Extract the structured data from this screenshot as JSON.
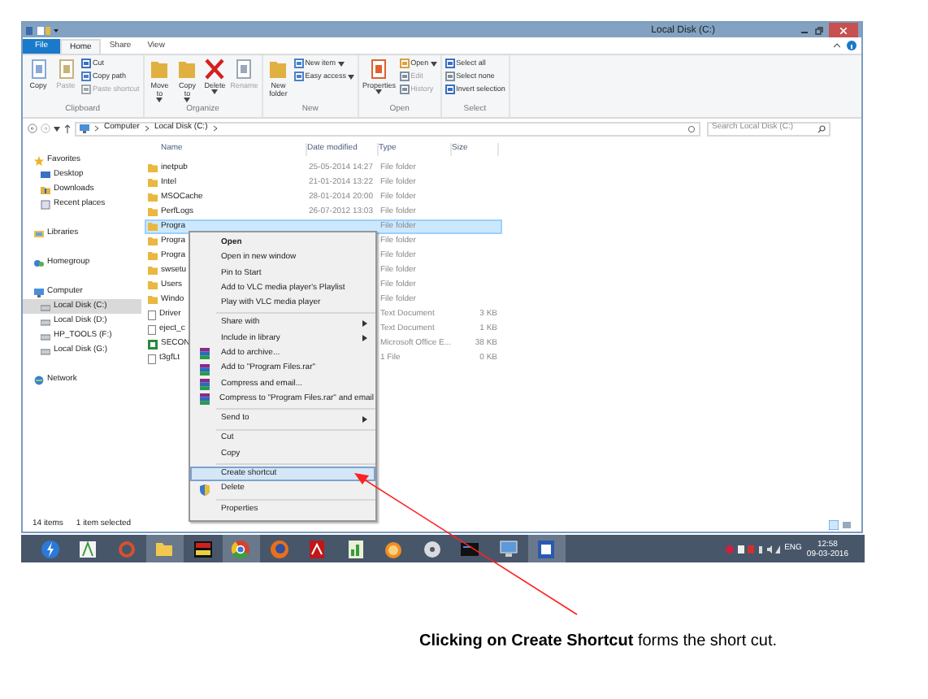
{
  "window": {
    "title": "Local Disk (C:)"
  },
  "ribbon_tabs": [
    {
      "label": "File",
      "kind": "file",
      "selected": false
    },
    {
      "label": "Home",
      "kind": "tab",
      "selected": true
    },
    {
      "label": "Share",
      "kind": "tab",
      "selected": false
    },
    {
      "label": "View",
      "kind": "tab",
      "selected": false
    }
  ],
  "ribbon_groups": [
    {
      "label": "Clipboard",
      "items": [
        {
          "label": "Copy",
          "kind": "large",
          "menu": false,
          "disabled": false
        },
        {
          "label": "Paste",
          "kind": "large",
          "menu": false,
          "disabled": true
        },
        {
          "label": "Cut",
          "kind": "small",
          "menu": false,
          "disabled": false
        },
        {
          "label": "Copy path",
          "kind": "small",
          "menu": false,
          "disabled": false
        },
        {
          "label": "Paste shortcut",
          "kind": "small",
          "menu": false,
          "disabled": true
        }
      ]
    },
    {
      "label": "Organize",
      "items": [
        {
          "label": "Move to",
          "kind": "large",
          "menu": true,
          "disabled": false
        },
        {
          "label": "Copy to",
          "kind": "large",
          "menu": true,
          "disabled": false
        },
        {
          "label": "Delete",
          "kind": "large",
          "menu": true,
          "disabled": false
        },
        {
          "label": "Rename",
          "kind": "large",
          "menu": false,
          "disabled": true
        }
      ]
    },
    {
      "label": "New",
      "items": [
        {
          "label": "New folder",
          "kind": "large",
          "menu": false,
          "disabled": false
        },
        {
          "label": "New item",
          "kind": "small",
          "menu": true,
          "disabled": false
        },
        {
          "label": "Easy access",
          "kind": "small",
          "menu": true,
          "disabled": false
        }
      ]
    },
    {
      "label": "Open",
      "items": [
        {
          "label": "Properties",
          "kind": "large",
          "menu": true,
          "disabled": false
        },
        {
          "label": "Open",
          "kind": "small",
          "menu": true,
          "disabled": false
        },
        {
          "label": "Edit",
          "kind": "small",
          "menu": false,
          "disabled": true
        },
        {
          "label": "History",
          "kind": "small",
          "menu": false,
          "disabled": true
        }
      ]
    },
    {
      "label": "Select",
      "items": [
        {
          "label": "Select all",
          "kind": "small",
          "menu": false,
          "disabled": false
        },
        {
          "label": "Select none",
          "kind": "small",
          "menu": false,
          "disabled": false
        },
        {
          "label": "Invert selection",
          "kind": "small",
          "menu": false,
          "disabled": false
        }
      ]
    }
  ],
  "address": {
    "path": [
      "Computer",
      "Local Disk (C:)"
    ]
  },
  "search": {
    "placeholder": "Search Local Disk (C:)"
  },
  "sidebar": [
    {
      "label": "Favorites",
      "kind": "star",
      "selected": false,
      "children": [
        {
          "label": "Desktop",
          "kind": "desktop",
          "selected": false
        },
        {
          "label": "Downloads",
          "kind": "downloads",
          "selected": false
        },
        {
          "label": "Recent places",
          "kind": "recent",
          "selected": false
        }
      ]
    },
    {
      "label": "Libraries",
      "kind": "library",
      "selected": false
    },
    {
      "label": "Homegroup",
      "kind": "homegroup",
      "selected": false
    },
    {
      "label": "Computer",
      "kind": "computer",
      "selected": false,
      "children": [
        {
          "label": "Local Disk (C:)",
          "kind": "drive",
          "selected": true
        },
        {
          "label": "Local Disk (D:)",
          "kind": "drive",
          "selected": false
        },
        {
          "label": "HP_TOOLS (F:)",
          "kind": "drive",
          "selected": false
        },
        {
          "label": "Local Disk (G:)",
          "kind": "drive",
          "selected": false
        }
      ]
    },
    {
      "label": "Network",
      "kind": "network",
      "selected": false
    }
  ],
  "columns": [
    "Name",
    "Date modified",
    "Type",
    "Size"
  ],
  "rows": [
    {
      "name": "inetpub",
      "date": "25-05-2014 14:27",
      "type": "File folder",
      "kind": "folder",
      "selected": false
    },
    {
      "name": "Intel",
      "date": "21-01-2014 13:22",
      "type": "File folder",
      "kind": "folder",
      "selected": false
    },
    {
      "name": "MSOCache",
      "date": "28-01-2014 20:00",
      "type": "File folder",
      "kind": "folder",
      "selected": false
    },
    {
      "name": "PerfLogs",
      "date": "26-07-2012 13:03",
      "type": "File folder",
      "kind": "folder",
      "selected": false
    },
    {
      "name": "Progra",
      "type": "File folder",
      "kind": "folder",
      "selected": true
    },
    {
      "name": "Progra",
      "type": "File folder",
      "kind": "folder",
      "selected": false
    },
    {
      "name": "Progra",
      "type": "File folder",
      "kind": "folder",
      "selected": false
    },
    {
      "name": "swsetu",
      "type": "File folder",
      "kind": "folder",
      "selected": false
    },
    {
      "name": "Users",
      "type": "File folder",
      "kind": "folder",
      "selected": false
    },
    {
      "name": "Windo",
      "type": "File folder",
      "kind": "folder",
      "selected": false
    },
    {
      "name": "Driver",
      "type": "Text Document",
      "size": "3 KB",
      "kind": "text",
      "selected": false
    },
    {
      "name": "eject_c",
      "type": "Text Document",
      "size": "1 KB",
      "kind": "text",
      "selected": false
    },
    {
      "name": "SECON",
      "type": "Microsoft Office E...",
      "size": "38 KB",
      "kind": "sheet",
      "selected": false
    },
    {
      "name": "t3gfLt",
      "type": "1 File",
      "size": "0 KB",
      "kind": "text",
      "selected": false
    }
  ],
  "context_menu": [
    [
      {
        "label": "Open",
        "kind": "plain",
        "default": true,
        "submenu": false,
        "selected": false
      },
      {
        "label": "Open in new window",
        "kind": "plain",
        "default": false,
        "submenu": false,
        "selected": false
      },
      {
        "label": "Pin to Start",
        "kind": "plain",
        "default": false,
        "submenu": false,
        "selected": false
      },
      {
        "label": "Add to VLC media player's Playlist",
        "kind": "plain",
        "default": false,
        "submenu": false,
        "selected": false
      },
      {
        "label": "Play with VLC media player",
        "kind": "plain",
        "default": false,
        "submenu": false,
        "selected": false
      }
    ],
    [
      {
        "label": "Share with",
        "kind": "plain",
        "default": false,
        "submenu": true,
        "selected": false
      },
      {
        "label": "Include in library",
        "kind": "plain",
        "default": false,
        "submenu": true,
        "selected": false
      },
      {
        "label": "Add to archive...",
        "kind": "archive",
        "default": false,
        "submenu": false,
        "selected": false
      },
      {
        "label": "Add to \"Program Files.rar\"",
        "kind": "archive",
        "default": false,
        "submenu": false,
        "selected": false
      },
      {
        "label": "Compress and email...",
        "kind": "archive",
        "default": false,
        "submenu": false,
        "selected": false
      },
      {
        "label": "Compress to \"Program Files.rar\" and email",
        "kind": "archive",
        "default": false,
        "submenu": false,
        "selected": false
      }
    ],
    [
      {
        "label": "Send to",
        "kind": "plain",
        "default": false,
        "submenu": true,
        "selected": false
      }
    ],
    [
      {
        "label": "Cut",
        "kind": "plain",
        "default": false,
        "submenu": false,
        "selected": false
      },
      {
        "label": "Copy",
        "kind": "plain",
        "default": false,
        "submenu": false,
        "selected": false
      }
    ],
    [
      {
        "label": "Create shortcut",
        "kind": "plain",
        "default": false,
        "submenu": false,
        "selected": true
      },
      {
        "label": "Delete",
        "kind": "shield",
        "default": false,
        "submenu": false,
        "selected": false
      }
    ],
    [
      {
        "label": "Properties",
        "kind": "plain",
        "default": false,
        "submenu": false,
        "selected": false
      }
    ]
  ],
  "status_bar": {
    "count": "14 items",
    "selection": "1 item selected"
  },
  "taskbar": {
    "apps": [
      {
        "kind": "bolt",
        "active": false
      },
      {
        "kind": "paint",
        "active": false
      },
      {
        "kind": "ring",
        "active": false
      },
      {
        "kind": "folder",
        "active": true
      },
      {
        "kind": "media",
        "active": false
      },
      {
        "kind": "chrome",
        "active": true
      },
      {
        "kind": "firefox",
        "active": false
      },
      {
        "kind": "pdf",
        "active": false
      },
      {
        "kind": "chart",
        "active": false
      },
      {
        "kind": "clock",
        "active": false
      },
      {
        "kind": "disc",
        "active": false
      },
      {
        "kind": "terminal",
        "active": false
      },
      {
        "kind": "monitor",
        "active": false
      },
      {
        "kind": "word",
        "active": true
      }
    ],
    "language": "ENG",
    "time": "12:58",
    "date": "09-03-2016"
  },
  "caption": "**Clicking on Create Shortcut** forms the short cut."
}
